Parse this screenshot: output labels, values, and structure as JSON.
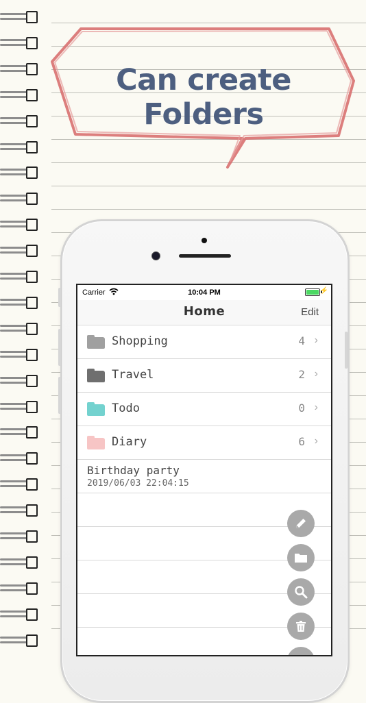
{
  "headline": "Can create Folders",
  "status_bar": {
    "carrier": "Carrier",
    "time": "10:04 PM"
  },
  "nav": {
    "title": "Home",
    "edit_label": "Edit"
  },
  "folders": [
    {
      "name": "Shopping",
      "count": "4",
      "color": "#a0a0a0"
    },
    {
      "name": "Travel",
      "count": "2",
      "color": "#6f6f6f"
    },
    {
      "name": "Todo",
      "count": "0",
      "color": "#73d2cf"
    },
    {
      "name": "Diary",
      "count": "6",
      "color": "#f7c5c5"
    }
  ],
  "notes": [
    {
      "title": "Birthday party",
      "date": "2019/06/03 22:04:15"
    }
  ],
  "actions": [
    {
      "icon": "pencil-icon"
    },
    {
      "icon": "folder-icon"
    },
    {
      "icon": "search-icon"
    },
    {
      "icon": "trash-icon"
    }
  ],
  "colors": {
    "headline": "#4d5f80",
    "bubble_outline": "#d87070",
    "background": "#fbfaf3",
    "fab": "#a9a9a9"
  }
}
